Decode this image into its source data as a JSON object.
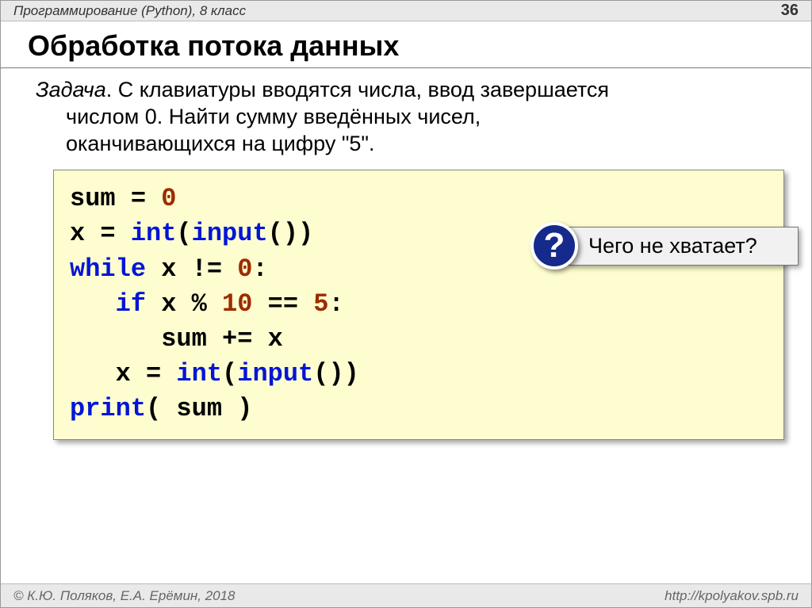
{
  "header": {
    "course": "Программирование (Python), 8 класс",
    "page": "36"
  },
  "title": "Обработка потока данных",
  "task": {
    "label": "Задача",
    "line1": ". С клавиатуры вводятся числа, ввод завершается",
    "line2": "числом 0. Найти сумму введённых чисел,",
    "line3": "оканчивающихся на цифру \"5\"."
  },
  "code": {
    "l1": {
      "a": "sum",
      "b": " = ",
      "c": "0"
    },
    "l2": {
      "a": "x",
      "b": " = ",
      "c": "int",
      "d": "(",
      "e": "input",
      "f": "())"
    },
    "l3": {
      "a": "while",
      "b": " x != ",
      "c": "0",
      "d": ":"
    },
    "l4": {
      "pad": "   ",
      "a": "if",
      "b": " x % ",
      "c": "10",
      "d": " == ",
      "e": "5",
      "f": ":"
    },
    "l5": {
      "pad": "      ",
      "a": "sum += x"
    },
    "l6": {
      "pad": "   ",
      "a": "x",
      "b": " = ",
      "c": "int",
      "d": "(",
      "e": "input",
      "f": "())"
    },
    "l7": {
      "a": "print",
      "b": "( sum )"
    }
  },
  "callout": {
    "mark": "?",
    "text": "Чего не хватает?"
  },
  "footer": {
    "left": "© К.Ю. Поляков, Е.А. Ерёмин, 2018",
    "right": "http://kpolyakov.spb.ru"
  }
}
